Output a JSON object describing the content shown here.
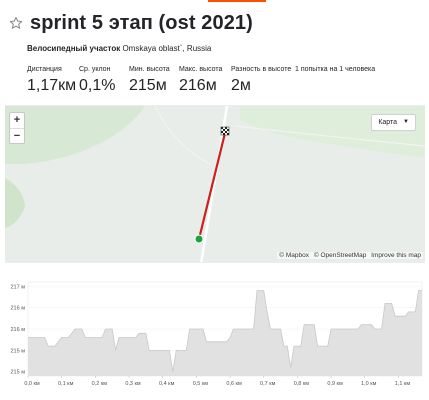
{
  "segment": {
    "title": "sprint 5 этап (ost 2021)",
    "type_label": "Велосипедный участок",
    "location": "Omskaya oblast`, Russia"
  },
  "stats": [
    {
      "label": "Дистанция",
      "value": "1,17км"
    },
    {
      "label": "Ср. уклон",
      "value": "0,1%"
    },
    {
      "label": "Мин. высота",
      "value": "215м"
    },
    {
      "label": "Макс. высота",
      "value": "216м"
    },
    {
      "label": "Разность в высоте",
      "value": "2м"
    },
    {
      "label": "1 попытка на 1 человека",
      "value": ""
    }
  ],
  "map": {
    "zoom_in": "+",
    "zoom_out": "−",
    "map_type": "Карта",
    "attribution": [
      "© Mapbox",
      "© OpenStreetMap",
      "Improve this map"
    ],
    "route_color": "#cc1f1f",
    "start_color": "#1aa33a"
  },
  "elevation": {
    "y_ticks": [
      "217 м",
      "216 м",
      "216 м",
      "215 м",
      "215 м"
    ],
    "x_ticks": [
      "0,0 км",
      "0,1 км",
      "0,2 км",
      "0,3 км",
      "0,4 км",
      "0,5 км",
      "0,6 км",
      "0,7 км",
      "0,8 км",
      "0,9 км",
      "1,0 км",
      "1,1 км"
    ],
    "fill_color": "#e1e1e1",
    "line_color": "#c8c8c8"
  },
  "chart_data": {
    "type": "area",
    "xlabel": "",
    "ylabel": "",
    "ylim": [
      214.9,
      217.1
    ],
    "x": [
      0,
      0.01,
      0.02,
      0.03,
      0.04,
      0.05,
      0.06,
      0.07,
      0.08,
      0.09,
      0.1,
      0.11,
      0.12,
      0.13,
      0.14,
      0.15,
      0.16,
      0.17,
      0.18,
      0.19,
      0.2,
      0.21,
      0.22,
      0.23,
      0.24,
      0.25,
      0.26,
      0.27,
      0.28,
      0.29,
      0.3,
      0.31,
      0.32,
      0.33,
      0.34,
      0.35,
      0.36,
      0.37,
      0.38,
      0.39,
      0.4,
      0.41,
      0.42,
      0.43,
      0.44,
      0.45,
      0.46,
      0.47,
      0.48,
      0.49,
      0.5,
      0.51,
      0.52,
      0.53,
      0.54,
      0.55,
      0.56,
      0.57,
      0.58,
      0.59,
      0.6,
      0.61,
      0.62,
      0.63,
      0.64,
      0.65,
      0.66,
      0.67,
      0.68,
      0.69,
      0.7,
      0.71,
      0.72,
      0.73,
      0.74,
      0.75,
      0.76,
      0.77,
      0.78,
      0.79,
      0.8,
      0.81,
      0.82,
      0.83,
      0.84,
      0.85,
      0.86,
      0.87,
      0.88,
      0.89,
      0.9,
      0.91,
      0.92,
      0.93,
      0.94,
      0.95,
      0.96,
      0.97,
      0.98,
      0.99,
      1.0,
      1.01,
      1.02,
      1.03,
      1.04,
      1.05,
      1.06,
      1.07,
      1.08,
      1.09,
      1.1,
      1.11,
      1.12,
      1.13,
      1.14,
      1.15,
      1.16,
      1.17
    ],
    "y": [
      215.8,
      215.8,
      215.8,
      215.8,
      215.8,
      215.8,
      215.6,
      215.6,
      215.6,
      215.7,
      215.8,
      215.8,
      215.8,
      215.9,
      216.0,
      216.0,
      216.0,
      215.8,
      215.8,
      215.8,
      215.8,
      215.8,
      215.8,
      216.0,
      216.0,
      216.0,
      215.5,
      215.8,
      215.8,
      215.8,
      215.8,
      215.8,
      215.8,
      215.9,
      215.9,
      215.9,
      215.5,
      215.5,
      215.5,
      215.5,
      215.5,
      215.5,
      215.5,
      215.0,
      215.5,
      215.5,
      215.5,
      215.5,
      216.0,
      216.0,
      216.0,
      216.0,
      216.0,
      215.7,
      215.7,
      215.7,
      215.7,
      215.7,
      215.7,
      215.7,
      215.8,
      216.0,
      216.0,
      216.0,
      216.0,
      216.0,
      216.0,
      216.0,
      216.9,
      216.9,
      216.9,
      216.4,
      216.0,
      216.0,
      216.0,
      216.0,
      215.6,
      215.6,
      215.1,
      215.6,
      215.6,
      215.6,
      216.1,
      216.1,
      216.1,
      216.1,
      215.6,
      215.6,
      215.6,
      215.6,
      216.0,
      216.0,
      216.0,
      216.0,
      216.0,
      216.0,
      216.0,
      216.0,
      216.0,
      216.1,
      216.1,
      216.1,
      216.1,
      216.0,
      216.0,
      216.0,
      216.6,
      216.6,
      216.6,
      216.3,
      216.3,
      216.3,
      216.3,
      216.4,
      216.4,
      216.4,
      216.9,
      216.9
    ]
  }
}
